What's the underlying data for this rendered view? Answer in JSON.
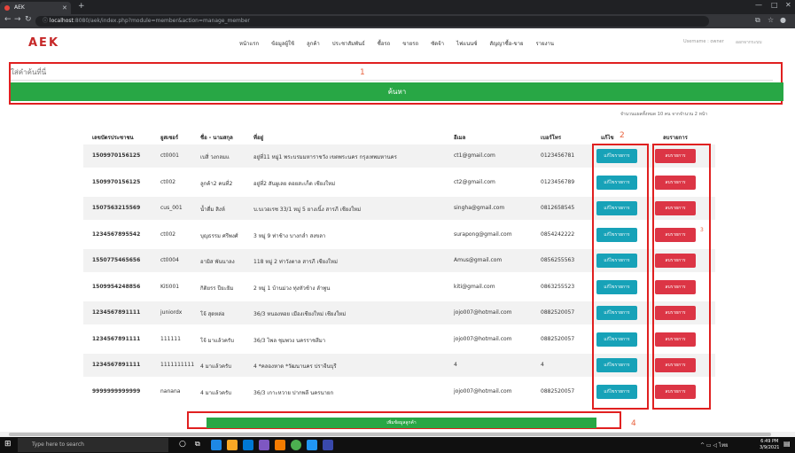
{
  "browser": {
    "tab_title": "AEK",
    "url_host": "localhost",
    "url_path": ":8080/aek/index.php?module=member&action=manage_member"
  },
  "app": {
    "logo": "AEK",
    "nav": [
      "หน้าแรก",
      "ข้อมูลผู้ใช้",
      "ลูกค้า",
      "ประชาสัมพันธ์",
      "ซื้อรถ",
      "ขายรถ",
      "ซัดจ้า",
      "ไฟแนนซ์",
      "สัญญาซื้อ-ขาย",
      "รายงาน"
    ],
    "user": "Username : owner",
    "logout": "ออกจากระบบ"
  },
  "search": {
    "placeholder": "ใส่คำค้นที่นี่",
    "button": "ค้นหา"
  },
  "annotations": {
    "a1": "1",
    "a2": "2",
    "a3": "3",
    "a4": "4"
  },
  "summary": "จำนวนแผลทั้งหมด 10 คน จากจำนวน 2 หน้า",
  "table": {
    "headers": [
      "เลขบัตรประชาชน",
      "ยูสเซอร์",
      "ชื่อ - นามสกุล",
      "ที่อยู่",
      "อีเมล",
      "เบอร์โทร",
      "แก้ไข",
      "ลบรายการ"
    ],
    "edit_label": "แก้ไขรายการ",
    "delete_label": "ลบรายการ",
    "rows": [
      [
        "1509970156125",
        "ct0001",
        "เบสิ่ วงกลมแ",
        "อยู่ที่11 หมู่1 พระบรมมหาราชวัง เขตพระนคร กรุงเทพมหานคร",
        "ct1@gmail.com",
        "0123456781"
      ],
      [
        "1509970156125",
        "ct002",
        "ลูกค้า2 คนที่2",
        "อยู่ที่2 สันผูเลย ดอยสะเก็ด เชียงใหม่",
        "ct2@gmail.com",
        "0123456789"
      ],
      [
        "1507563215569",
        "cus_001",
        "น้ำดื่ม สิงห์",
        "บ.บเวอเรซ 33/1 หมู่ 5 ยางเนิ้ง สารภี เชียงใหม่",
        "singha@gmail.com",
        "0812658545"
      ],
      [
        "1234567895542",
        "ct002",
        "บุญธรรม ศรีพงศ์",
        "3 หมู่ 9 ท่าช้าง บางกล่ำ สงขลา",
        "surapong@gmail.com",
        "0854242222"
      ],
      [
        "1550775465656",
        "ct0004",
        "อามิส พันนาลง",
        "118 หมู่ 2 ท่าวังตาล สารภี เชียงใหม่",
        "Amus@gmail.com",
        "0856255563"
      ],
      [
        "1509954248856",
        "Kiti001",
        "กิติยรร ปียะยิม",
        "2 หมู่ 1 บ้านม่วง ทุ่งหัวช้าง ลำพูน",
        "kiti@gmail.com",
        "0863255523"
      ],
      [
        "1234567891111",
        "juniordx",
        "โจ้ สุดหล่อ",
        "36/3 หนองหอย เมืองเชียงใหม่ เชียงใหม่",
        "jojo007@hotmail.com",
        "0882520057"
      ],
      [
        "1234567891111",
        "111111",
        "โจ้ มาแล้วครับ",
        "36/3 ไพล ชุมพวง นครราชสีมา",
        "jojo007@hotmail.com",
        "0882520057"
      ],
      [
        "1234567891111",
        "1111111111",
        "4 มาแล้วครับ",
        "4 *คลองหาด *วัฒนานคร ปราจีนบุรี",
        "4",
        "4"
      ],
      [
        "9999999999999",
        "nanana",
        "4 มาแล้วครับ",
        "36/3 เกาะหวาย ปากพลี นครนายก",
        "jojo007@hotmail.com",
        "0882520057"
      ]
    ]
  },
  "add_button": "เพิ่มข้อมูลลูกค้า",
  "taskbar": {
    "search_placeholder": "Type here to search",
    "time": "6:49 PM",
    "date": "3/9/2021",
    "lang": "ไทย"
  }
}
